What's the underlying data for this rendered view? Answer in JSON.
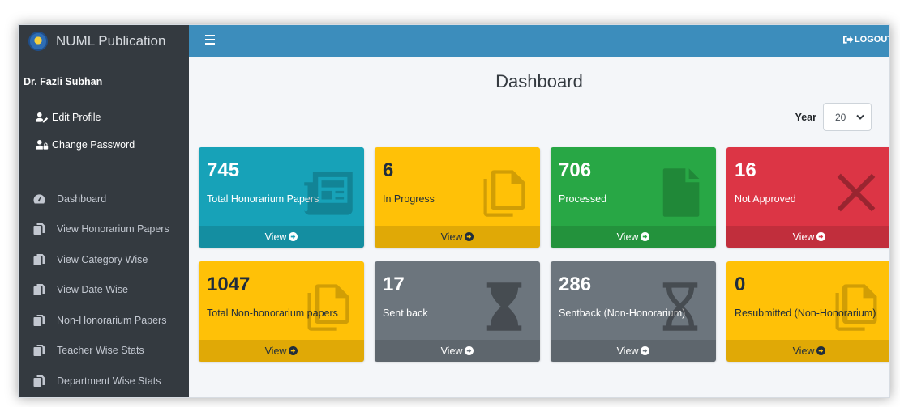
{
  "sidebar": {
    "brand": "NUML Publication",
    "user_name": "Dr. Fazli Subhan",
    "user_links": [
      {
        "label": "Edit Profile",
        "icon": "user-edit-icon"
      },
      {
        "label": "Change Password",
        "icon": "user-lock-icon"
      }
    ],
    "items": [
      {
        "label": "Dashboard",
        "icon": "tachometer-icon"
      },
      {
        "label": "View Honorarium Papers",
        "icon": "copy-icon"
      },
      {
        "label": "View Category Wise",
        "icon": "copy-icon"
      },
      {
        "label": "View Date Wise",
        "icon": "copy-icon"
      },
      {
        "label": "Non-Honorarium Papers",
        "icon": "copy-icon"
      },
      {
        "label": "Teacher Wise Stats",
        "icon": "copy-icon"
      },
      {
        "label": "Department Wise Stats",
        "icon": "copy-icon"
      }
    ]
  },
  "topbar": {
    "logout_label": "LOGOUT"
  },
  "main": {
    "title": "Dashboard",
    "year_label": "Year",
    "year_value": "20"
  },
  "cards": [
    {
      "value": "745",
      "label": "Total Honorarium Papers",
      "footer": "View",
      "color": "#17a2b8",
      "icon": "newspaper-icon"
    },
    {
      "value": "6",
      "label": "In Progress",
      "footer": "View",
      "color": "#ffc107",
      "icon": "copy-icon"
    },
    {
      "value": "706",
      "label": "Processed",
      "footer": "View",
      "color": "#28a745",
      "icon": "file-icon"
    },
    {
      "value": "16",
      "label": "Not Approved",
      "footer": "View",
      "color": "#dc3545",
      "icon": "times-icon"
    },
    {
      "value": "1047",
      "label": "Total Non-honorarium papers",
      "footer": "View",
      "color": "#ffc107",
      "icon": "copy-icon"
    },
    {
      "value": "17",
      "label": "Sent back",
      "footer": "View",
      "color": "#6c757d",
      "icon": "hourglass-icon"
    },
    {
      "value": "286",
      "label": "Sentback (Non-Honorarium)",
      "footer": "View",
      "color": "#6c757d",
      "icon": "hourglass-outline-icon"
    },
    {
      "value": "0",
      "label": "Resubmitted (Non-Honorarium)",
      "footer": "View",
      "color": "#ffc107",
      "icon": "copy-icon"
    }
  ]
}
